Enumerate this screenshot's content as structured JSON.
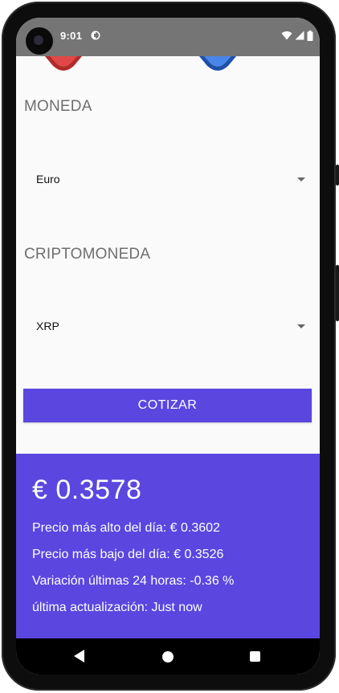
{
  "status_bar": {
    "time": "9:01",
    "icons": [
      "camera-icon",
      "app-notification-icon",
      "wifi-icon",
      "cell-signal-icon",
      "battery-icon"
    ]
  },
  "moneda": {
    "label": "MONEDA",
    "selected": "Euro"
  },
  "criptomoneda": {
    "label": "CRIPTOMONEDA",
    "selected": "XRP"
  },
  "cotizar_button": {
    "label": "COTIZAR"
  },
  "result": {
    "price": "€ 0.3578",
    "high": "Precio más alto del día:  € 0.3602",
    "low": "Precio más bajo del día:  € 0.3526",
    "change": "Variación últimas 24 horas:  -0.36 %",
    "updated": "última actualización:  Just now"
  },
  "nav_bar": {
    "icons": [
      "back-icon",
      "home-icon",
      "recents-icon"
    ]
  },
  "colors": {
    "accent": "#5b46e0",
    "status_bar": "#757575",
    "logo_red": "#d23c3c",
    "logo_blue": "#3a6fd8"
  }
}
